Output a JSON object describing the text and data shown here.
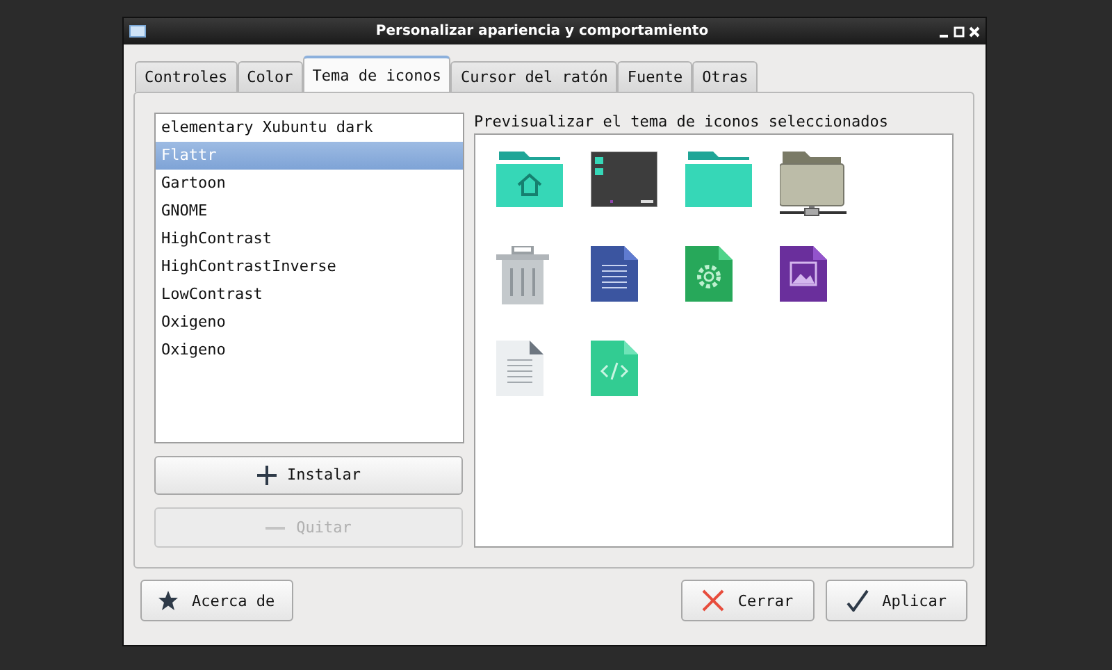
{
  "window": {
    "title": "Personalizar apariencia y comportamiento"
  },
  "tabs": [
    {
      "label": "Controles",
      "selected": false
    },
    {
      "label": "Color",
      "selected": false
    },
    {
      "label": "Tema de iconos",
      "selected": true
    },
    {
      "label": "Cursor del ratón",
      "selected": false
    },
    {
      "label": "Fuente",
      "selected": false
    },
    {
      "label": "Otras",
      "selected": false
    }
  ],
  "theme_list": [
    {
      "label": "elementary Xubuntu dark",
      "selected": false
    },
    {
      "label": "Flattr",
      "selected": true
    },
    {
      "label": "Gartoon",
      "selected": false
    },
    {
      "label": "GNOME",
      "selected": false
    },
    {
      "label": "HighContrast",
      "selected": false
    },
    {
      "label": "HighContrastInverse",
      "selected": false
    },
    {
      "label": "LowContrast",
      "selected": false
    },
    {
      "label": "Oxigeno",
      "selected": false
    },
    {
      "label": "Oxigeno",
      "selected": false
    }
  ],
  "list_buttons": [
    {
      "label": "Instalar",
      "kind": "add",
      "disabled": false
    },
    {
      "label": "Quitar",
      "kind": "remove",
      "disabled": true
    }
  ],
  "preview": {
    "label": "Previsualizar el tema de iconos seleccionados"
  },
  "footer_buttons": [
    {
      "label": "Acerca de",
      "kind": "about"
    },
    {
      "label": "Cerrar",
      "kind": "close"
    },
    {
      "label": "Aplicar",
      "kind": "apply"
    }
  ]
}
